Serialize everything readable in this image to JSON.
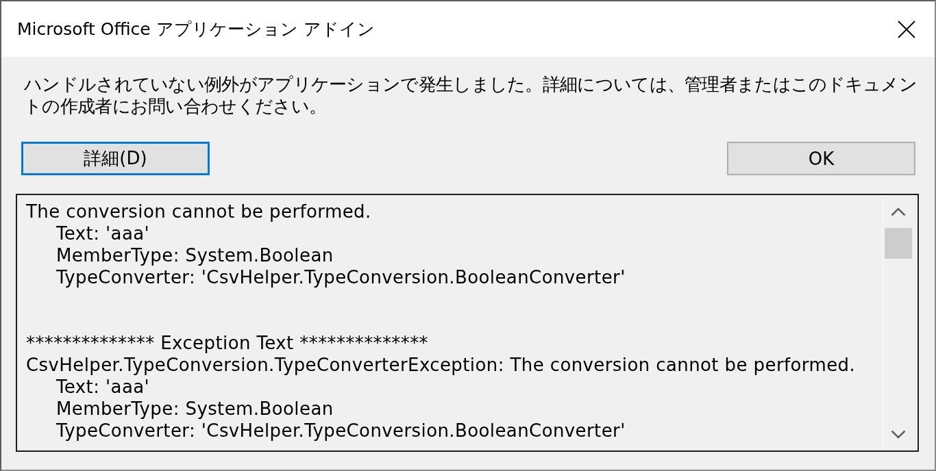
{
  "window": {
    "title": "Microsoft Office アプリケーション アドイン"
  },
  "message": "ハンドルされていない例外がアプリケーションで発生しました。詳細については、管理者またはこのドキュメントの作成者にお問い合わせください。",
  "buttons": [
    {
      "label": "詳細(D)",
      "focused": true
    },
    {
      "label": "OK",
      "focused": false
    }
  ],
  "details": {
    "sections": [
      {
        "lines": [
          {
            "text": "The conversion cannot be performed.",
            "children": [
              {
                "text": "Text: 'aaa'"
              },
              {
                "text": "MemberType: System.Boolean"
              },
              {
                "text": "TypeConverter: 'CsvHelper.TypeConversion.BooleanConverter'"
              }
            ]
          }
        ]
      },
      {
        "lines": [
          {
            "text": "************** Exception Text **************"
          },
          {
            "text": "CsvHelper.TypeConversion.TypeConverterException: The conversion cannot be performed.",
            "children": [
              {
                "text": "Text: 'aaa'"
              },
              {
                "text": "MemberType: System.Boolean"
              },
              {
                "text": "TypeConverter: 'CsvHelper.TypeConversion.BooleanConverter'"
              }
            ]
          }
        ]
      }
    ]
  }
}
